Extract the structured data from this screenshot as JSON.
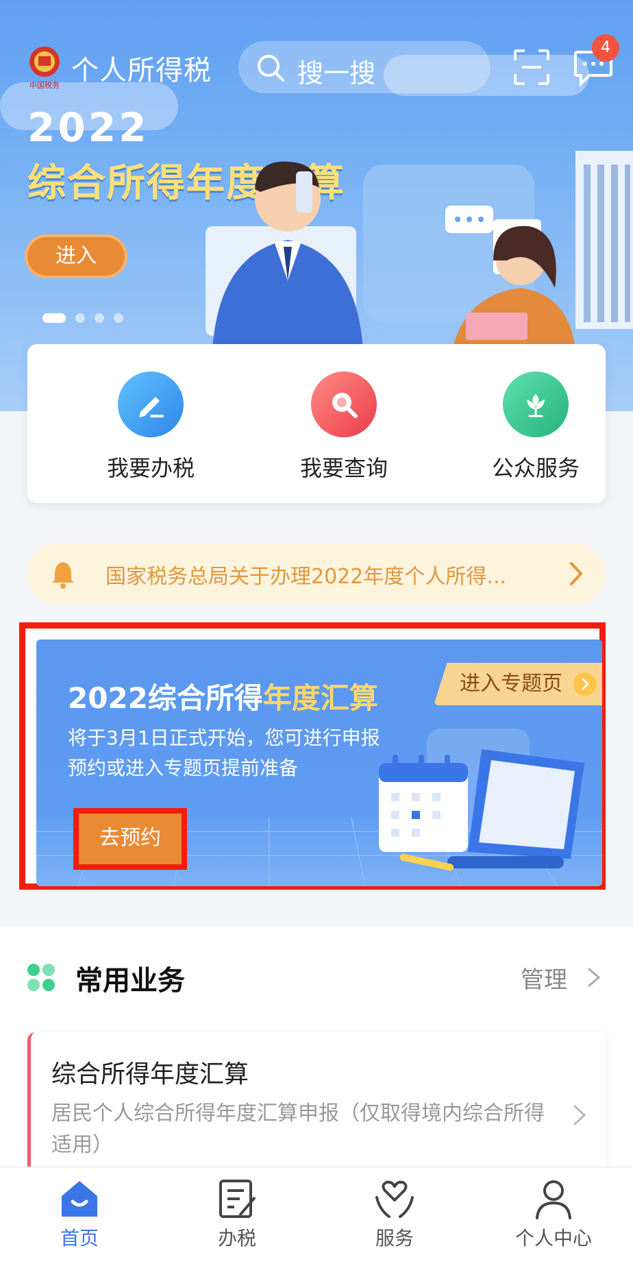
{
  "header": {
    "app_title": "个人所得税",
    "search_placeholder": "搜一搜",
    "message_count": "4"
  },
  "banner": {
    "year": "2022",
    "heading": "综合所得年度汇算",
    "enter_label": "进入",
    "slides": 4,
    "active_slide": 1
  },
  "quick_actions": [
    {
      "label": "我要办税",
      "icon": "edit-icon",
      "color": "#3a9cf0"
    },
    {
      "label": "我要查询",
      "icon": "search-icon",
      "color": "#f2545b"
    },
    {
      "label": "公众服务",
      "icon": "flower-icon",
      "color": "#2ec38b"
    }
  ],
  "notice": {
    "text": "国家税务总局关于办理2022年度个人所得..."
  },
  "promo": {
    "title_part1": "2022综合所得",
    "title_part2": "年度汇算",
    "description": "将于3月1日正式开始，您可进行申报预约或进入专题页提前准备",
    "topic_button": "进入专题页",
    "book_button": "去预约"
  },
  "common_business": {
    "title": "常用业务",
    "manage_label": "管理",
    "items": [
      {
        "title": "综合所得年度汇算",
        "description": "居民个人综合所得年度汇算申报（仅取得境内综合所得适用）"
      }
    ]
  },
  "tabbar": {
    "items": [
      {
        "label": "首页",
        "icon": "home-icon",
        "active": true
      },
      {
        "label": "办税",
        "icon": "document-edit-icon",
        "active": false
      },
      {
        "label": "服务",
        "icon": "heart-hands-icon",
        "active": false
      },
      {
        "label": "个人中心",
        "icon": "person-icon",
        "active": false
      }
    ]
  },
  "colors": {
    "primary": "#3b76e6",
    "accent_orange": "#e98b34",
    "highlight_red": "#f21d0e",
    "notice_text": "#e0973b"
  }
}
